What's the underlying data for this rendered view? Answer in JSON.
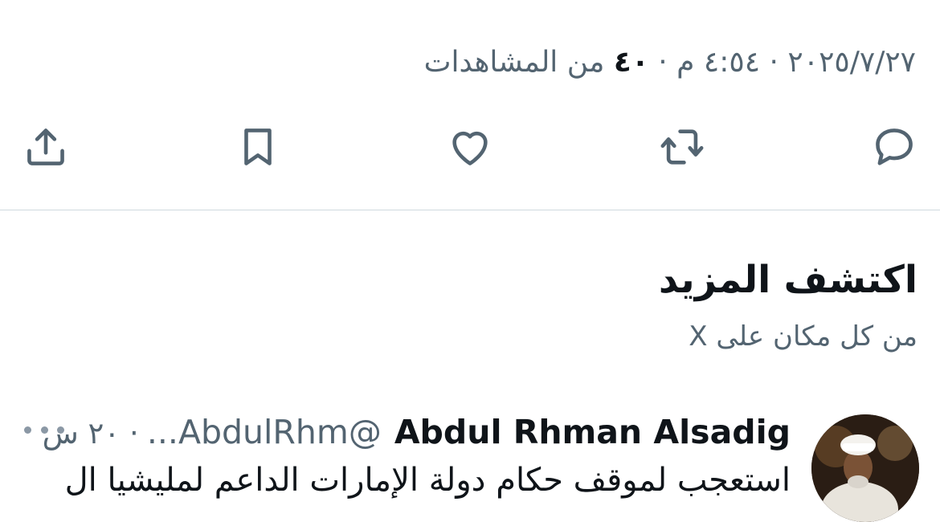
{
  "meta": {
    "date": "٢٠٢٥/٧/٢٧",
    "sep1": " · ",
    "time": "٤:٥٤ م",
    "sep2": " · ",
    "views_count": "٤٠",
    "views_label": " من المشاهدات"
  },
  "actions": {
    "reply_icon": "reply-icon",
    "repost_icon": "repost-icon",
    "like_icon": "like-icon",
    "bookmark_icon": "bookmark-icon",
    "share_icon": "share-icon"
  },
  "discover": {
    "title": "اكتشف المزيد",
    "subtitle": "من كل مكان على X"
  },
  "tweet": {
    "author_name": "Abdul Rhman Alsadig",
    "author_handle": "@AbdulRhm...",
    "sep": " · ",
    "time": "٢٠ س",
    "text": "استعجب لموقف حكام دولة الإمارات الداعم لمليشيا ال"
  },
  "colors": {
    "text_primary": "#0f1419",
    "text_secondary": "#536471",
    "divider": "#cfd9de"
  }
}
